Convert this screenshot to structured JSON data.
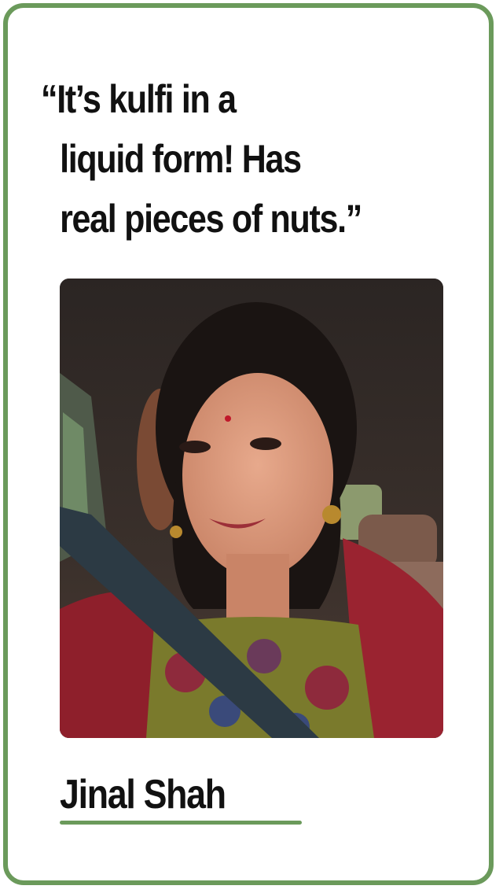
{
  "testimonial": {
    "quote_lines": [
      "“It’s kulfi in a",
      "liquid form! Has",
      "real pieces of nuts.”"
    ],
    "author_name": "Jinal Shah"
  },
  "colors": {
    "accent": "#6b9a5b",
    "text": "#111111",
    "background": "#ffffff"
  }
}
